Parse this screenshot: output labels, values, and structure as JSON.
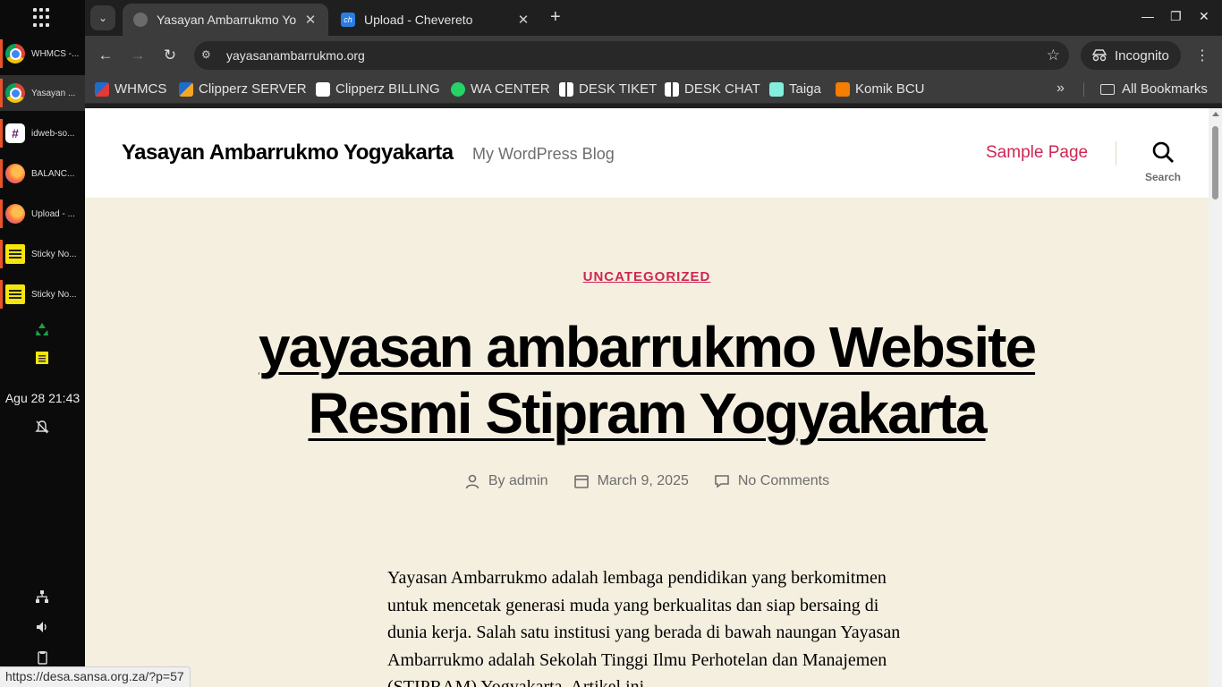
{
  "dock": {
    "tasks": [
      {
        "label": "WHMCS -...",
        "icon": "chrome-icon"
      },
      {
        "label": "Yasayan ...",
        "icon": "chrome-icon"
      },
      {
        "label": "idweb-so...",
        "icon": "slack-icon"
      },
      {
        "label": "BALANC...",
        "icon": "firefox-icon"
      },
      {
        "label": "Upload - ...",
        "icon": "firefox-icon"
      },
      {
        "label": "Sticky No...",
        "icon": "sticky-notes-icon"
      },
      {
        "label": "Sticky No...",
        "icon": "sticky-notes-icon"
      }
    ],
    "clock": "Agu 28  21:43",
    "tray_icons": [
      "recycle-icon",
      "notes-icon",
      "notifications-off-icon",
      "network-icon",
      "volume-icon",
      "clipboard-icon"
    ]
  },
  "browser": {
    "tabs": [
      {
        "title": "Yasayan Ambarrukmo Yogyakarta",
        "active": true
      },
      {
        "title": "Upload - Chevereto",
        "active": false
      }
    ],
    "url": "yayasanambarrukmo.org",
    "incognito_label": "Incognito",
    "bookmarks": [
      {
        "label": "WHMCS",
        "color": "#1f6ccf"
      },
      {
        "label": "Clipperz SERVER",
        "color": "#1f6ccf"
      },
      {
        "label": "Clipperz BILLING",
        "color": "#ffffff"
      },
      {
        "label": "WA CENTER",
        "color": "#25d366"
      },
      {
        "label": "DESK TIKET",
        "color": "#ffffff"
      },
      {
        "label": "DESK CHAT",
        "color": "#ffffff"
      },
      {
        "label": "Taiga",
        "color": "#83eede"
      },
      {
        "label": "Komik BCU",
        "color": "#f57d00"
      }
    ],
    "all_bookmarks_label": "All Bookmarks",
    "status_url": "https://desa.sansa.org.za/?p=57"
  },
  "site": {
    "title": "Yasayan Ambarrukmo Yogyakarta",
    "description": "My WordPress Blog",
    "nav_link": "Sample Page",
    "search_label": "Search",
    "accent_color": "#cd2653"
  },
  "post": {
    "category": "UNCATEGORIZED",
    "title": "yayasan ambarrukmo Website Resmi Stipram Yogyakarta",
    "by_label": "By",
    "author": "admin",
    "date": "March 9, 2025",
    "comments": "No Comments",
    "content": "Yayasan Ambarrukmo adalah lembaga pendidikan yang berkomitmen untuk mencetak generasi muda yang berkualitas dan siap bersaing di dunia kerja. Salah satu institusi yang berada di bawah naungan Yayasan Ambarrukmo adalah Sekolah Tinggi Ilmu Perhotelan dan Manajemen (STIPRAM) Yogyakarta. Artikel ini"
  }
}
